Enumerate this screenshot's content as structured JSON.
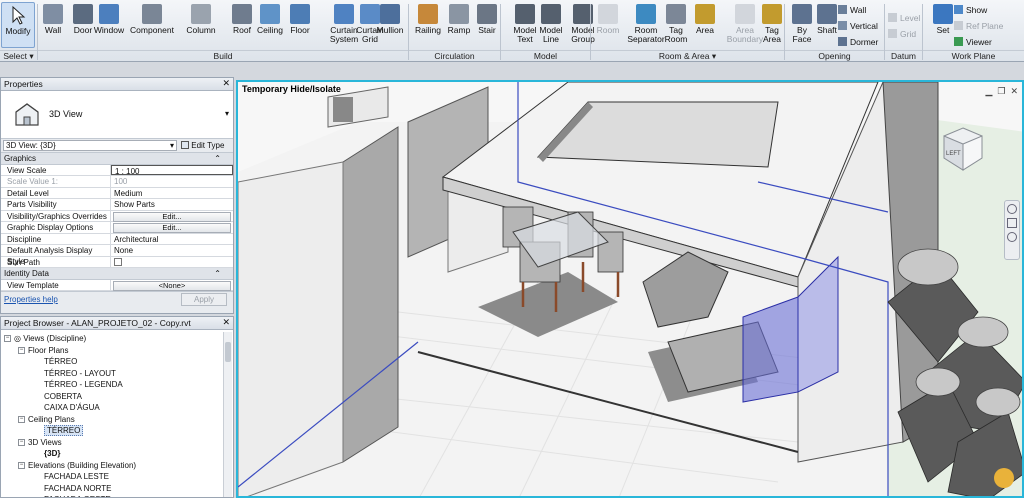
{
  "ribbon": {
    "tools": [
      {
        "name": "modify",
        "label": "Modify"
      },
      {
        "name": "wall",
        "label": "Wall"
      },
      {
        "name": "door",
        "label": "Door"
      },
      {
        "name": "window",
        "label": "Window"
      },
      {
        "name": "component",
        "label": "Component"
      },
      {
        "name": "column",
        "label": "Column"
      },
      {
        "name": "roof",
        "label": "Roof"
      },
      {
        "name": "ceiling",
        "label": "Ceiling"
      },
      {
        "name": "floor",
        "label": "Floor"
      },
      {
        "name": "curtain-system",
        "label": "Curtain\nSystem"
      },
      {
        "name": "curtain-grid",
        "label": "Curtain\nGrid"
      },
      {
        "name": "mullion",
        "label": "Mullion"
      },
      {
        "name": "railing",
        "label": "Railing"
      },
      {
        "name": "ramp",
        "label": "Ramp"
      },
      {
        "name": "stair",
        "label": "Stair"
      },
      {
        "name": "model-text",
        "label": "Model\nText"
      },
      {
        "name": "model-line",
        "label": "Model\nLine"
      },
      {
        "name": "model-group",
        "label": "Model\nGroup"
      },
      {
        "name": "room",
        "label": "Room"
      },
      {
        "name": "room-separator",
        "label": "Room\nSeparator"
      },
      {
        "name": "tag-room",
        "label": "Tag\nRoom"
      },
      {
        "name": "area",
        "label": "Area"
      },
      {
        "name": "area-boundary",
        "label": "Area\nBoundary"
      },
      {
        "name": "tag-area",
        "label": "Tag\nArea"
      },
      {
        "name": "by-face",
        "label": "By\nFace"
      },
      {
        "name": "shaft",
        "label": "Shaft"
      },
      {
        "name": "set",
        "label": "Set"
      }
    ],
    "small": {
      "wall": "Wall",
      "vertical": "Vertical",
      "dormer": "Dormer",
      "level": "Level",
      "grid": "Grid",
      "show": "Show",
      "ref_plane": "Ref  Plane",
      "viewer": "Viewer"
    },
    "panels": {
      "select": "Select ▾",
      "build": "Build",
      "circulation": "Circulation",
      "model": "Model",
      "room_area": "Room & Area ▾",
      "opening": "Opening",
      "datum": "Datum",
      "work_plane": "Work Plane"
    }
  },
  "properties": {
    "title": "Properties",
    "type_name": "3D View",
    "selector": "3D View: {3D}",
    "edit_type": "Edit Type",
    "groups": {
      "graphics": "Graphics",
      "identity": "Identity Data"
    },
    "rows": [
      {
        "k": "View Scale",
        "v": "1 : 100"
      },
      {
        "k": "Scale Value    1:",
        "v": "100"
      },
      {
        "k": "Detail Level",
        "v": "Medium"
      },
      {
        "k": "Parts Visibility",
        "v": "Show Parts"
      },
      {
        "k": "Visibility/Graphics Overrides",
        "v": "Edit..."
      },
      {
        "k": "Graphic Display Options",
        "v": "Edit..."
      },
      {
        "k": "Discipline",
        "v": "Architectural"
      },
      {
        "k": "Default Analysis Display Style",
        "v": "None"
      },
      {
        "k": "Sun Path",
        "v": ""
      },
      {
        "k": "View Template",
        "v": "<None>"
      }
    ],
    "help": "Properties help",
    "apply": "Apply"
  },
  "browser": {
    "title": "Project Browser - ALAN_PROJETO_02 - Copy.rvt",
    "items": [
      {
        "label": "Views (Discipline)",
        "level": 0,
        "toggle": "−"
      },
      {
        "label": "Floor Plans",
        "level": 1,
        "toggle": "−"
      },
      {
        "label": "TÉRREO",
        "level": 2
      },
      {
        "label": "TÉRREO - LAYOUT",
        "level": 2
      },
      {
        "label": "TÉRREO - LEGENDA",
        "level": 2
      },
      {
        "label": "COBERTA",
        "level": 2
      },
      {
        "label": "CAIXA D'ÁGUA",
        "level": 2
      },
      {
        "label": "Ceiling Plans",
        "level": 1,
        "toggle": "−"
      },
      {
        "label": "TÉRREO",
        "level": 2,
        "hl": true
      },
      {
        "label": "3D Views",
        "level": 1,
        "toggle": "−"
      },
      {
        "label": "{3D}",
        "level": 2,
        "bold": true
      },
      {
        "label": "Elevations (Building Elevation)",
        "level": 1,
        "toggle": "−"
      },
      {
        "label": "FACHADA LESTE",
        "level": 2
      },
      {
        "label": "FACHADA NORTE",
        "level": 2
      },
      {
        "label": "FACHADA OESTE",
        "level": 2
      }
    ]
  },
  "viewport": {
    "banner": "Temporary Hide/Isolate",
    "viewcube_face": "LEFT",
    "accent": "#29b6d9"
  }
}
